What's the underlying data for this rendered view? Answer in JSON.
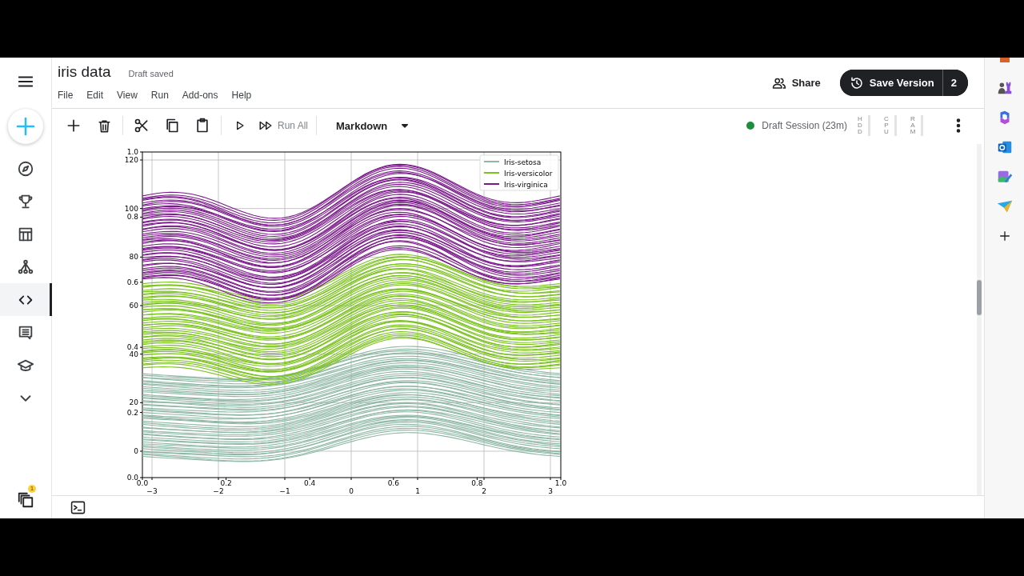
{
  "window": {
    "title": "iris data",
    "save_status": "Draft saved"
  },
  "menu": [
    {
      "label": "File"
    },
    {
      "label": "Edit"
    },
    {
      "label": "View"
    },
    {
      "label": "Run"
    },
    {
      "label": "Add-ons"
    },
    {
      "label": "Help"
    }
  ],
  "header": {
    "share": "Share",
    "save_version": "Save Version",
    "version_count": "2"
  },
  "rail": {
    "items": [
      {
        "selected": false
      },
      {
        "selected": false
      },
      {
        "selected": false
      },
      {
        "selected": false
      },
      {
        "selected": true
      },
      {
        "selected": false
      },
      {
        "selected": false
      },
      {
        "selected": false
      }
    ],
    "notifications": "1"
  },
  "toolbar": {
    "run_all": "Run All",
    "cell_type": "Markdown"
  },
  "session": {
    "label": "Draft Session (23m)",
    "active": true
  },
  "meters": [
    {
      "label": "HDD"
    },
    {
      "label": "CPU"
    },
    {
      "label": "RAM"
    }
  ],
  "plot": {
    "y_ticks_outer": [
      "1.0",
      "0.8",
      "0.6",
      "0.4",
      "0.2",
      "0.0"
    ],
    "y_ticks_inner": [
      "120",
      "100",
      "80",
      "60",
      "40",
      "20",
      "0"
    ],
    "x_ticks_outer": [
      "0.0",
      "0.2",
      "0.4",
      "0.6",
      "0.8",
      "1.0"
    ],
    "x_ticks_inner": [
      "−3",
      "−2",
      "−1",
      "0",
      "1",
      "2",
      "3"
    ],
    "legend": [
      {
        "label": "Iris-setosa",
        "color": "#8fb8a5"
      },
      {
        "label": "Iris-versicolor",
        "color": "#7cc220"
      },
      {
        "label": "Iris-virginica",
        "color": "#7a1a8a"
      }
    ]
  }
}
